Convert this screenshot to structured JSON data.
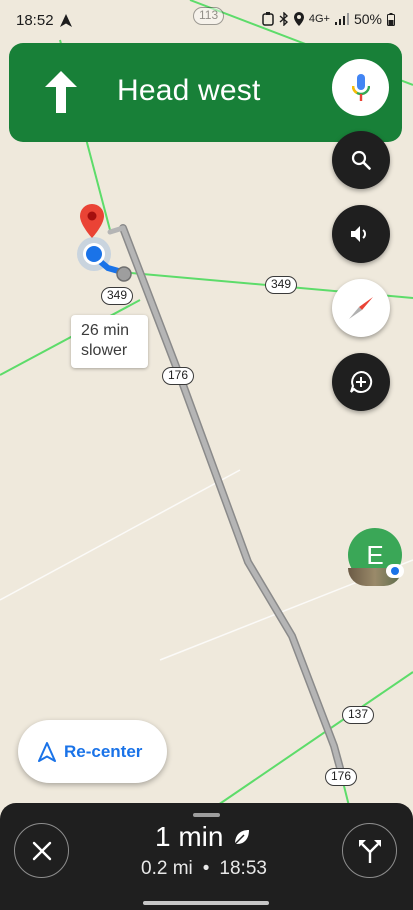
{
  "status_bar": {
    "time": "18:52",
    "battery": "50%",
    "network": "4G+"
  },
  "navigation": {
    "instruction": "Head west",
    "direction_icon": "arrow-up-icon",
    "banner_color": "#188038"
  },
  "map": {
    "road_labels": [
      "113",
      "349",
      "349",
      "176",
      "137",
      "176"
    ],
    "callout": {
      "line1": "26 min",
      "line2": "slower"
    },
    "avatar_initial": "E"
  },
  "controls": {
    "search_icon": "search-icon",
    "sound_icon": "volume-icon",
    "compass_icon": "compass-icon",
    "report_icon": "add-report-icon",
    "recenter_label": "Re-center"
  },
  "trip": {
    "duration": "1 min",
    "distance": "0.2 mi",
    "separator": "•",
    "arrival": "18:53"
  },
  "colors": {
    "route_gray": "#9e9e9e",
    "user_blue": "#1a73e8",
    "road_green": "#4cd964",
    "accent": "#1a73e8"
  }
}
